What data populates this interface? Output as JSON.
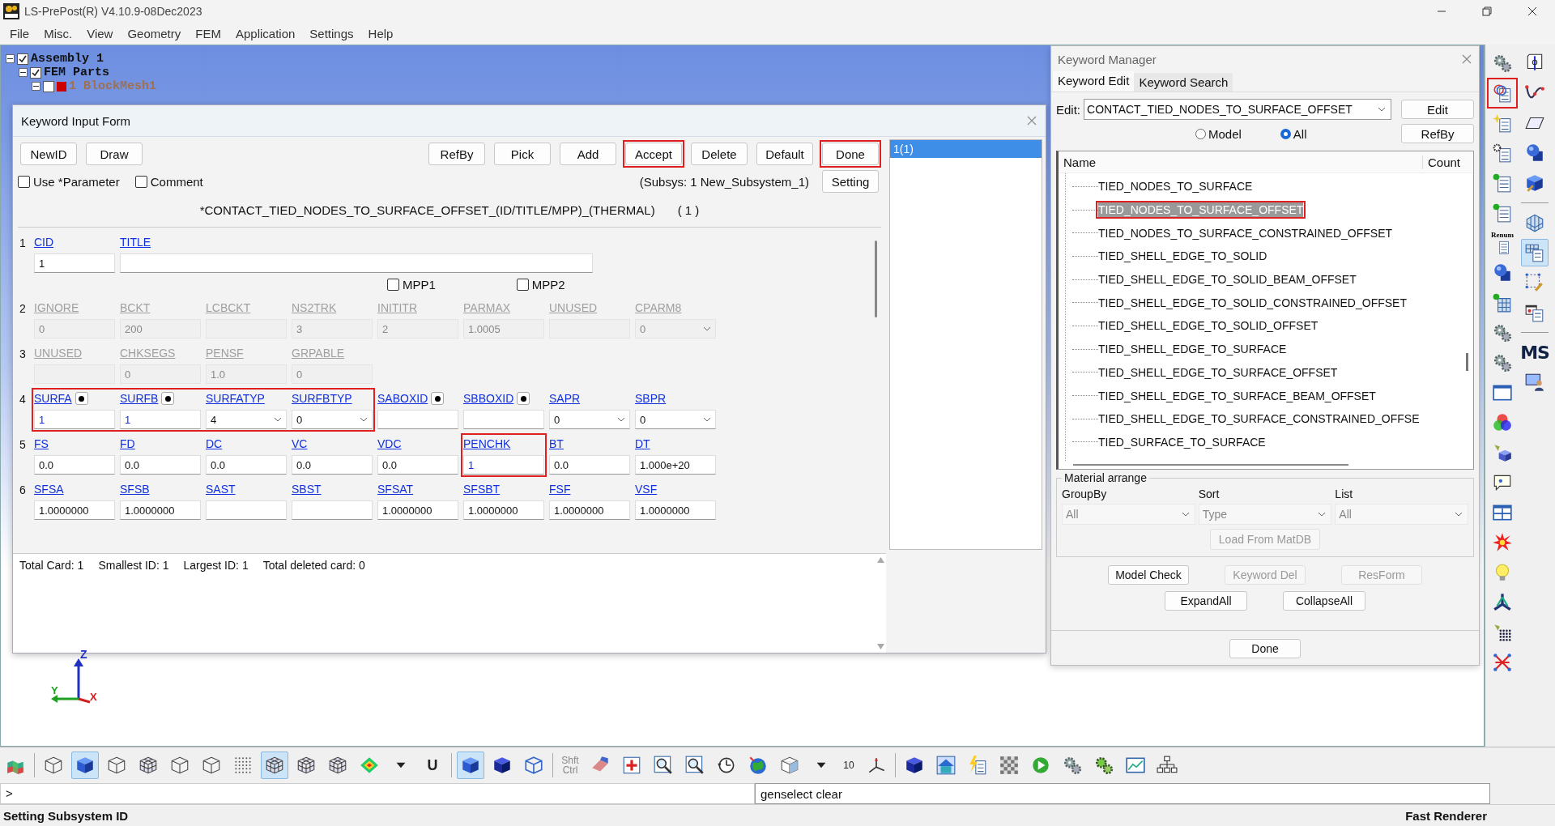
{
  "window": {
    "title": "LS-PrePost(R) V4.10.9-08Dec2023"
  },
  "menu": [
    "File",
    "Misc.",
    "View",
    "Geometry",
    "FEM",
    "Application",
    "Settings",
    "Help"
  ],
  "model_tree": {
    "items": [
      {
        "label": "Assembly 1",
        "checked": true,
        "children": [
          {
            "label": "FEM Parts",
            "checked": true,
            "children": [
              {
                "label": "1 BlockMesh1",
                "checked": false,
                "color": "#cc0000"
              }
            ]
          }
        ]
      }
    ]
  },
  "keyword_form": {
    "title": "Keyword Input Form",
    "left_buttons": [
      {
        "label": "NewID",
        "highlighted": false
      },
      {
        "label": "Draw",
        "highlighted": false
      }
    ],
    "right_buttons": [
      {
        "label": "RefBy",
        "highlighted": false
      },
      {
        "label": "Pick",
        "highlighted": false
      },
      {
        "label": "Add",
        "highlighted": false
      },
      {
        "label": "Accept",
        "highlighted": true
      },
      {
        "label": "Delete",
        "highlighted": false
      },
      {
        "label": "Default",
        "highlighted": false
      },
      {
        "label": "Done",
        "highlighted": true
      }
    ],
    "options": [
      {
        "label": "Use *Parameter",
        "checked": false
      },
      {
        "label": "Comment",
        "checked": false
      }
    ],
    "subsystem": "(Subsys: 1 New_Subsystem_1)",
    "setting_button": "Setting",
    "keyword": "*CONTACT_TIED_NODES_TO_SURFACE_OFFSET_(ID/TITLE/MPP)_(THERMAL)",
    "keyword_count": "( 1 )",
    "cards": [
      {
        "number": "1",
        "groups": [
          {
            "highlighted": false,
            "fields": [
              {
                "label": "CID",
                "value": "1",
                "kind": "text",
                "disabled": false,
                "modified": false,
                "pick": false
              },
              {
                "label": "TITLE",
                "kind": "wide",
                "disabled": false,
                "pick": false
              }
            ]
          }
        ],
        "options": [
          {
            "label": "MPP1",
            "checked": false
          },
          {
            "label": "MPP2",
            "checked": false
          }
        ]
      },
      {
        "number": "2",
        "groups": [
          {
            "highlighted": false,
            "fields": [
              {
                "label": "IGNORE",
                "value": "0",
                "kind": "text",
                "disabled": true,
                "modified": false,
                "pick": false
              },
              {
                "label": "BCKT",
                "value": "200",
                "kind": "text",
                "disabled": true,
                "modified": false,
                "pick": false
              },
              {
                "label": "LCBCKT",
                "kind": "text",
                "disabled": true,
                "pick": false
              },
              {
                "label": "NS2TRK",
                "value": "3",
                "kind": "text",
                "disabled": true,
                "modified": false,
                "pick": false
              },
              {
                "label": "INITITR",
                "value": "2",
                "kind": "text",
                "disabled": true,
                "modified": false,
                "pick": false
              },
              {
                "label": "PARMAX",
                "value": "1.0005",
                "kind": "text",
                "disabled": true,
                "modified": false,
                "pick": false
              },
              {
                "label": "UNUSED",
                "kind": "text",
                "disabled": true,
                "pick": false
              },
              {
                "label": "CPARM8",
                "value": "0",
                "kind": "select",
                "disabled": true,
                "modified": false,
                "pick": false
              }
            ]
          }
        ]
      },
      {
        "number": "3",
        "groups": [
          {
            "highlighted": false,
            "fields": [
              {
                "label": "UNUSED",
                "kind": "text",
                "disabled": true,
                "pick": false
              },
              {
                "label": "CHKSEGS",
                "value": "0",
                "kind": "text",
                "disabled": true,
                "modified": false,
                "pick": false
              },
              {
                "label": "PENSF",
                "value": "1.0",
                "kind": "text",
                "disabled": true,
                "modified": false,
                "pick": false
              },
              {
                "label": "GRPABLE",
                "value": "0",
                "kind": "text",
                "disabled": true,
                "modified": false,
                "pick": false
              }
            ]
          }
        ]
      },
      {
        "number": "4",
        "groups": [
          {
            "highlighted": true,
            "fields": [
              {
                "label": "SURFA",
                "value": "1",
                "kind": "text",
                "disabled": false,
                "modified": true,
                "pick": true
              },
              {
                "label": "SURFB",
                "value": "1",
                "kind": "text",
                "disabled": false,
                "modified": true,
                "pick": true
              },
              {
                "label": "SURFATYP",
                "value": "4",
                "kind": "select",
                "disabled": false,
                "modified": false,
                "pick": false
              },
              {
                "label": "SURFBTYP",
                "value": "0",
                "kind": "select",
                "disabled": false,
                "modified": false,
                "pick": false
              }
            ]
          },
          {
            "highlighted": false,
            "fields": [
              {
                "label": "SABOXID",
                "kind": "text",
                "disabled": false,
                "pick": true
              },
              {
                "label": "SBBOXID",
                "kind": "text",
                "disabled": false,
                "pick": true
              },
              {
                "label": "SAPR",
                "value": "0",
                "kind": "select",
                "disabled": false,
                "modified": false,
                "pick": false
              },
              {
                "label": "SBPR",
                "value": "0",
                "kind": "select",
                "disabled": false,
                "modified": false,
                "pick": false
              }
            ]
          }
        ]
      },
      {
        "number": "5",
        "groups": [
          {
            "highlighted": false,
            "fields": [
              {
                "label": "FS",
                "value": "0.0",
                "kind": "text",
                "disabled": false,
                "modified": false,
                "pick": false
              },
              {
                "label": "FD",
                "value": "0.0",
                "kind": "text",
                "disabled": false,
                "modified": false,
                "pick": false
              },
              {
                "label": "DC",
                "value": "0.0",
                "kind": "text",
                "disabled": false,
                "modified": false,
                "pick": false
              },
              {
                "label": "VC",
                "value": "0.0",
                "kind": "text",
                "disabled": false,
                "modified": false,
                "pick": false
              },
              {
                "label": "VDC",
                "value": "0.0",
                "kind": "text",
                "disabled": false,
                "modified": false,
                "pick": false
              }
            ]
          },
          {
            "highlighted": true,
            "fields": [
              {
                "label": "PENCHK",
                "value": "1",
                "kind": "text",
                "disabled": false,
                "modified": true,
                "pick": false
              }
            ]
          },
          {
            "highlighted": false,
            "fields": [
              {
                "label": "BT",
                "value": "0.0",
                "kind": "text",
                "disabled": false,
                "modified": false,
                "pick": false
              },
              {
                "label": "DT",
                "value": "1.000e+20",
                "kind": "text",
                "disabled": false,
                "modified": false,
                "pick": false
              }
            ]
          }
        ]
      },
      {
        "number": "6",
        "groups": [
          {
            "highlighted": false,
            "fields": [
              {
                "label": "SFSA",
                "value": "1.0000000",
                "kind": "text",
                "disabled": false,
                "modified": false,
                "pick": false
              },
              {
                "label": "SFSB",
                "value": "1.0000000",
                "kind": "text",
                "disabled": false,
                "modified": false,
                "pick": false
              },
              {
                "label": "SAST",
                "kind": "text",
                "disabled": false,
                "pick": false
              },
              {
                "label": "SBST",
                "kind": "text",
                "disabled": false,
                "pick": false
              },
              {
                "label": "SFSAT",
                "value": "1.0000000",
                "kind": "text",
                "disabled": false,
                "modified": false,
                "pick": false
              },
              {
                "label": "SFSBT",
                "value": "1.0000000",
                "kind": "text",
                "disabled": false,
                "modified": false,
                "pick": false
              },
              {
                "label": "FSF",
                "value": "1.0000000",
                "kind": "text",
                "disabled": false,
                "modified": false,
                "pick": false
              },
              {
                "label": "VSF",
                "value": "1.0000000",
                "kind": "text",
                "disabled": false,
                "modified": false,
                "pick": false
              }
            ]
          }
        ]
      }
    ],
    "summary": [
      "Total Card: 1",
      "Smallest ID: 1",
      "Largest ID: 1",
      "Total deleted card:  0"
    ],
    "id_list": [
      {
        "label": "1(1)",
        "selected": true
      }
    ]
  },
  "keyword_manager": {
    "title": "Keyword Manager",
    "tabs": [
      {
        "label": "Keyword Edit",
        "selected": true
      },
      {
        "label": "Keyword Search",
        "selected": false
      }
    ],
    "edit_label": "Edit:",
    "edit_value": "CONTACT_TIED_NODES_TO_SURFACE_OFFSET",
    "edit_button": "Edit",
    "scope": [
      {
        "label": "Model",
        "selected": false
      },
      {
        "label": "All",
        "selected": true
      }
    ],
    "refby_button": "RefBy",
    "columns": [
      "Name",
      "Count"
    ],
    "items": [
      {
        "label": "TIED_NODES_TO_SURFACE",
        "selected": false,
        "highlighted": false
      },
      {
        "label": "TIED_NODES_TO_SURFACE_OFFSET",
        "selected": true,
        "highlighted": true
      },
      {
        "label": "TIED_NODES_TO_SURFACE_CONSTRAINED_OFFSET",
        "selected": false,
        "highlighted": false
      },
      {
        "label": "TIED_SHELL_EDGE_TO_SOLID",
        "selected": false,
        "highlighted": false
      },
      {
        "label": "TIED_SHELL_EDGE_TO_SOLID_BEAM_OFFSET",
        "selected": false,
        "highlighted": false
      },
      {
        "label": "TIED_SHELL_EDGE_TO_SOLID_CONSTRAINED_OFFSET",
        "selected": false,
        "highlighted": false
      },
      {
        "label": "TIED_SHELL_EDGE_TO_SOLID_OFFSET",
        "selected": false,
        "highlighted": false
      },
      {
        "label": "TIED_SHELL_EDGE_TO_SURFACE",
        "selected": false,
        "highlighted": false
      },
      {
        "label": "TIED_SHELL_EDGE_TO_SURFACE_OFFSET",
        "selected": false,
        "highlighted": false
      },
      {
        "label": "TIED_SHELL_EDGE_TO_SURFACE_BEAM_OFFSET",
        "selected": false,
        "highlighted": false
      },
      {
        "label": "TIED_SHELL_EDGE_TO_SURFACE_CONSTRAINED_OFFSE",
        "selected": false,
        "highlighted": false
      },
      {
        "label": "TIED_SURFACE_TO_SURFACE",
        "selected": false,
        "highlighted": false
      }
    ],
    "material_arrange": {
      "title": "Material arrange",
      "selects": [
        {
          "label": "GroupBy",
          "value": "All",
          "disabled": true
        },
        {
          "label": "Sort",
          "value": "Type",
          "disabled": true
        },
        {
          "label": "List",
          "value": "All",
          "disabled": true
        }
      ],
      "load_button": {
        "label": "Load From MatDB",
        "disabled": true
      }
    },
    "buttons": [
      {
        "label": "Model Check",
        "disabled": false
      },
      {
        "label": "Keyword Del",
        "disabled": true
      },
      {
        "label": "ResForm",
        "disabled": true
      }
    ],
    "expand_buttons": [
      "ExpandAll",
      "CollapseAll"
    ],
    "done_button": "Done"
  },
  "triad": {
    "labels": [
      "Z",
      "Y",
      "X"
    ]
  },
  "right_toolbar": {
    "columns": [
      {
        "groups": [
          [
            {
              "selected": false,
              "highlighted": false
            },
            {
              "selected": false,
              "highlighted": true
            },
            {
              "selected": false,
              "highlighted": false
            },
            {
              "selected": false,
              "highlighted": false
            },
            {
              "selected": false,
              "highlighted": false
            },
            {
              "selected": false,
              "highlighted": false
            },
            {
              "selected": false,
              "highlighted": false,
              "label": "Renum"
            },
            {
              "selected": false,
              "highlighted": false
            },
            {
              "selected": false,
              "highlighted": false
            },
            {
              "selected": false,
              "highlighted": false
            },
            {
              "selected": false,
              "highlighted": false
            },
            {
              "selected": false,
              "highlighted": false
            },
            {
              "selected": false,
              "highlighted": false
            },
            {
              "selected": false,
              "highlighted": false
            },
            {
              "selected": false,
              "highlighted": false
            },
            {
              "selected": false,
              "highlighted": false
            },
            {
              "selected": false,
              "highlighted": false
            },
            {
              "selected": false,
              "highlighted": false
            },
            {
              "selected": false,
              "highlighted": false
            },
            {
              "selected": false,
              "highlighted": false
            },
            {
              "selected": false,
              "highlighted": false
            }
          ]
        ]
      },
      {
        "groups": [
          [
            {
              "selected": false,
              "highlighted": false
            },
            {
              "selected": false,
              "highlighted": false
            },
            {
              "selected": false,
              "highlighted": false
            },
            {
              "selected": false,
              "highlighted": false
            },
            {
              "selected": false,
              "highlighted": false
            }
          ],
          [
            {
              "selected": false,
              "highlighted": false
            },
            {
              "selected": true,
              "highlighted": false
            },
            {
              "selected": false,
              "highlighted": false
            },
            {
              "selected": false,
              "highlighted": false
            }
          ],
          [
            {
              "selected": false,
              "highlighted": false,
              "label": "MS"
            },
            {
              "selected": false,
              "highlighted": false
            }
          ]
        ]
      }
    ]
  },
  "bottom_toolbar": {
    "groups": [
      [
        {
          "selected": false
        }
      ],
      [
        {
          "selected": false
        },
        {
          "selected": true
        },
        {
          "selected": false
        },
        {
          "selected": false
        },
        {
          "selected": false
        },
        {
          "selected": false
        },
        {
          "selected": false
        },
        {
          "selected": true
        },
        {
          "selected": false
        },
        {
          "selected": false
        },
        {
          "selected": false
        },
        {
          "selected": false
        },
        {
          "selected": false,
          "label": "U"
        }
      ],
      [
        {
          "selected": true
        },
        {
          "selected": false
        },
        {
          "selected": false
        }
      ],
      [
        {
          "selected": false,
          "label": "Shft Ctrl"
        },
        {
          "selected": false
        },
        {
          "selected": false
        },
        {
          "selected": false
        },
        {
          "selected": false
        },
        {
          "selected": false
        },
        {
          "selected": false
        },
        {
          "selected": false
        },
        {
          "selected": false
        },
        {
          "selected": false,
          "label": "10"
        },
        {
          "selected": false
        }
      ],
      [
        {
          "selected": false
        },
        {
          "selected": false
        },
        {
          "selected": false
        },
        {
          "selected": false
        },
        {
          "selected": false
        },
        {
          "selected": false
        },
        {
          "selected": false
        },
        {
          "selected": false
        },
        {
          "selected": false
        }
      ]
    ]
  },
  "command_line": {
    "prompt": ">",
    "value": "genselect clear"
  },
  "status_bar": {
    "message": "Setting Subsystem ID",
    "renderer": "Fast Renderer"
  }
}
